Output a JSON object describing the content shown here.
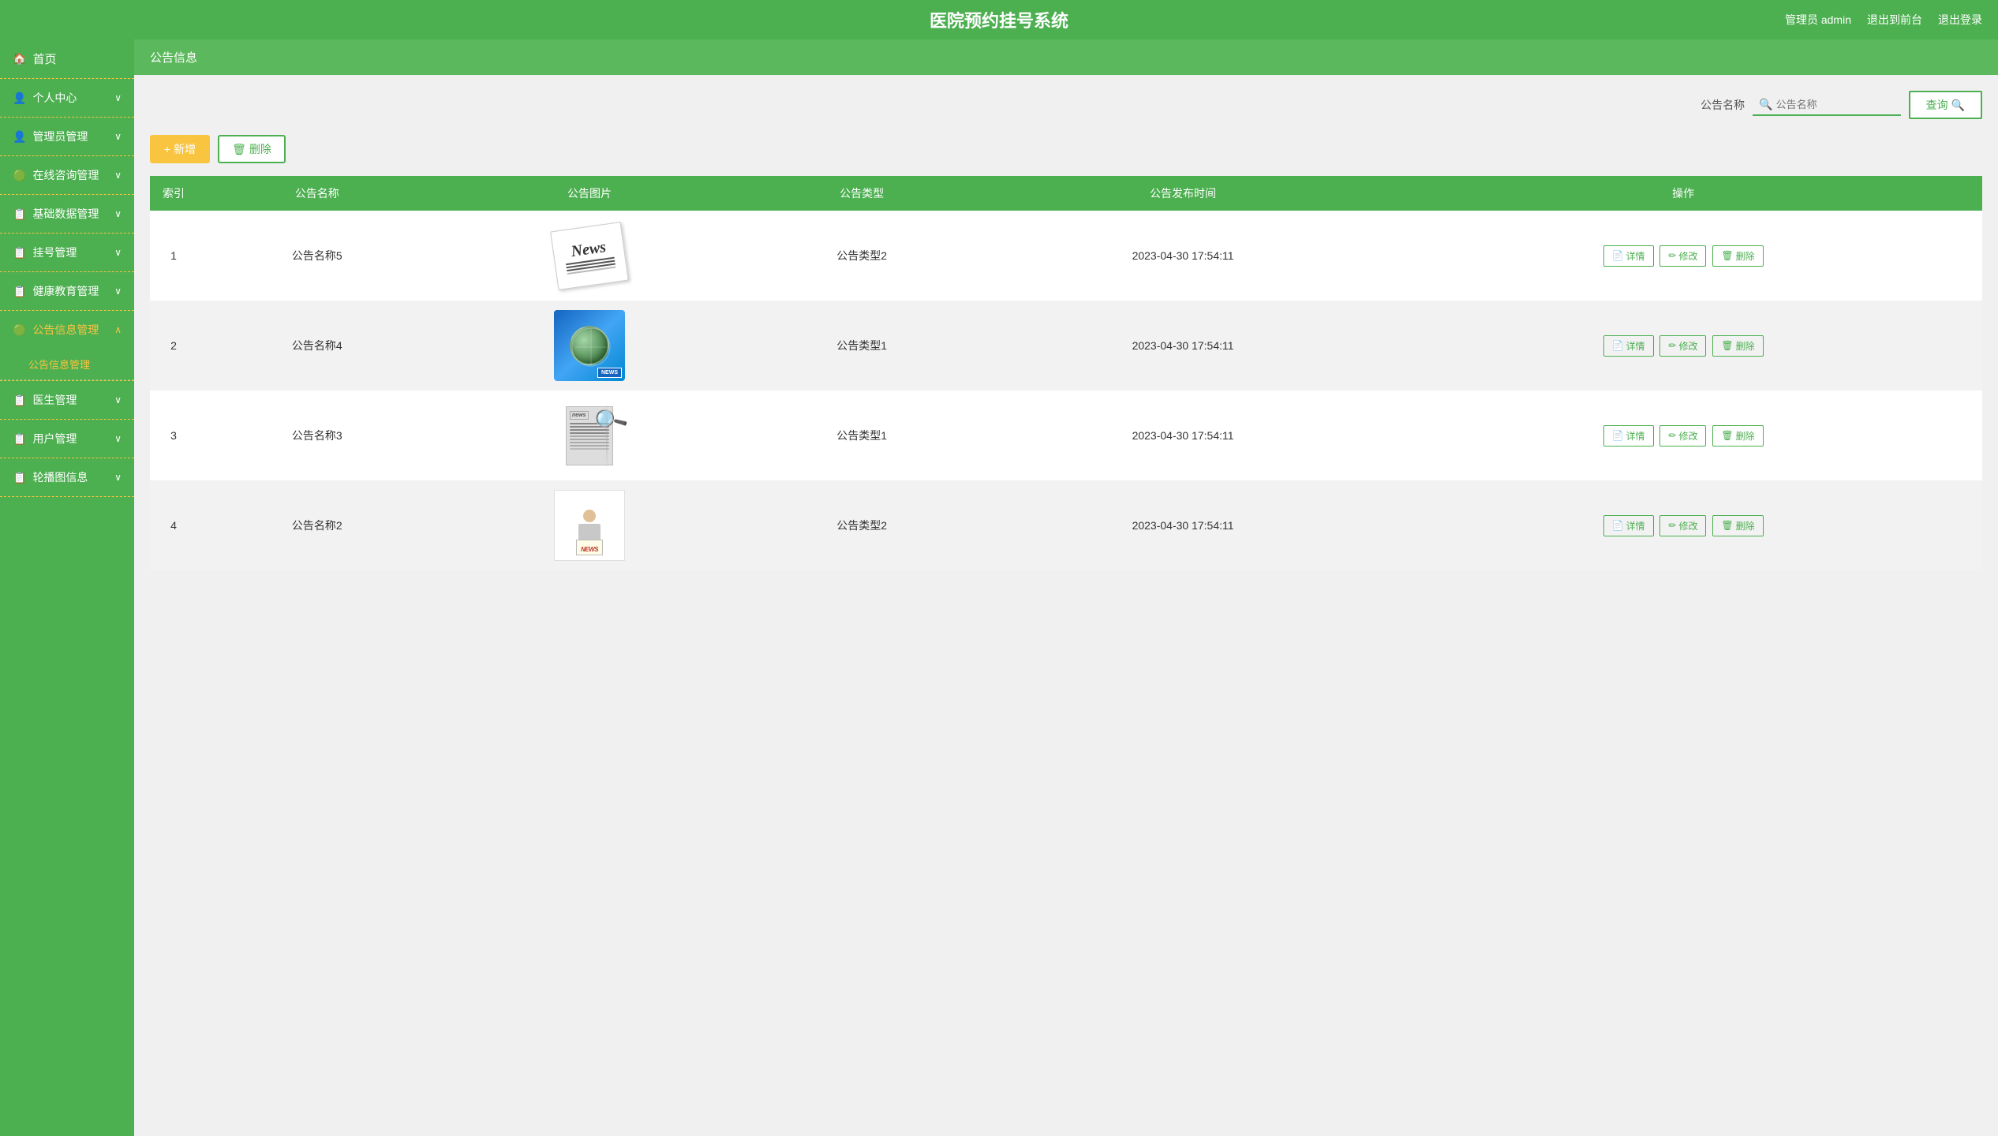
{
  "header": {
    "title": "医院预约挂号系统",
    "admin_label": "管理员 admin",
    "back_to_front": "退出到前台",
    "logout": "退出登录"
  },
  "sidebar": {
    "items": [
      {
        "id": "home",
        "label": "首页",
        "icon": "🏠",
        "active": false,
        "expandable": false
      },
      {
        "id": "personal",
        "label": "个人中心",
        "icon": "👤",
        "active": false,
        "expandable": true
      },
      {
        "id": "admin-mgmt",
        "label": "管理员管理",
        "icon": "👤",
        "active": false,
        "expandable": true
      },
      {
        "id": "online-consult",
        "label": "在线咨询管理",
        "icon": "🟢",
        "active": false,
        "expandable": true
      },
      {
        "id": "basic-data",
        "label": "基础数据管理",
        "icon": "📋",
        "active": false,
        "expandable": true
      },
      {
        "id": "appointment",
        "label": "挂号管理",
        "icon": "📋",
        "active": false,
        "expandable": true
      },
      {
        "id": "health-edu",
        "label": "健康教育管理",
        "icon": "📋",
        "active": false,
        "expandable": true
      },
      {
        "id": "notice-mgmt",
        "label": "公告信息管理",
        "icon": "🟢",
        "active": true,
        "expandable": true,
        "sub": [
          {
            "label": "公告信息管理",
            "active": true
          }
        ]
      },
      {
        "id": "doctor-mgmt",
        "label": "医生管理",
        "icon": "📋",
        "active": false,
        "expandable": true
      },
      {
        "id": "user-mgmt",
        "label": "用户管理",
        "icon": "📋",
        "active": false,
        "expandable": true
      },
      {
        "id": "banner-mgmt",
        "label": "轮播图信息",
        "icon": "📋",
        "active": false,
        "expandable": true
      }
    ]
  },
  "page": {
    "breadcrumb": "公告信息",
    "search_label": "公告名称",
    "search_placeholder": "公告名称",
    "search_btn": "查询",
    "add_btn": "+ 新增",
    "delete_btn": "删除",
    "table": {
      "columns": [
        "索引",
        "公告名称",
        "公告图片",
        "公告类型",
        "公告发布时间",
        "操作"
      ],
      "rows": [
        {
          "index": 1,
          "name": "公告名称5",
          "img_type": "newspaper",
          "type": "公告类型2",
          "time": "2023-04-30 17:54:11"
        },
        {
          "index": 2,
          "name": "公告名称4",
          "img_type": "globe",
          "type": "公告类型1",
          "time": "2023-04-30 17:54:11"
        },
        {
          "index": 3,
          "name": "公告名称3",
          "img_type": "magnifier",
          "type": "公告类型1",
          "time": "2023-04-30 17:54:11"
        },
        {
          "index": 4,
          "name": "公告名称2",
          "img_type": "figure",
          "type": "公告类型2",
          "time": "2023-04-30 17:54:11"
        }
      ],
      "op_detail": "详情",
      "op_edit": "修改",
      "op_delete": "删除"
    }
  },
  "colors": {
    "primary": "#4caf50",
    "accent": "#f9c440",
    "white": "#ffffff"
  }
}
